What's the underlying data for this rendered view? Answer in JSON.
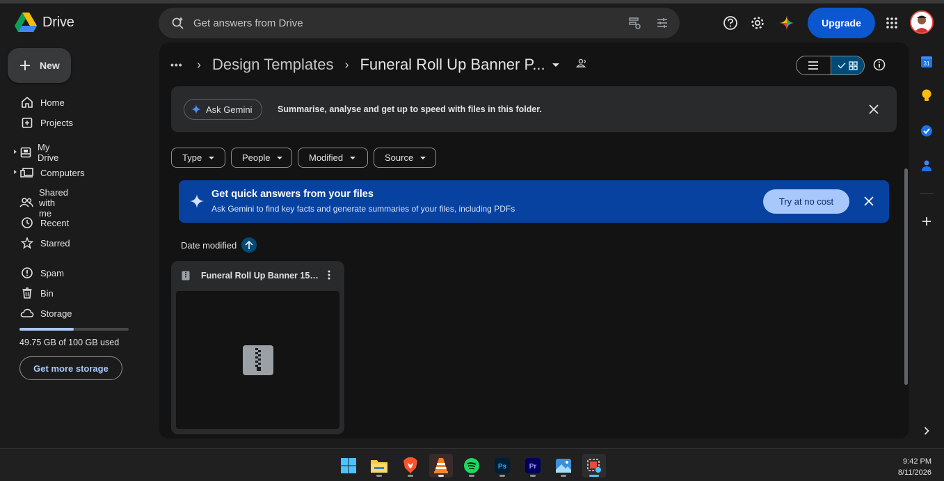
{
  "app": {
    "name": "Drive"
  },
  "search": {
    "placeholder": "Get answers from Drive"
  },
  "header": {
    "upgrade_label": "Upgrade"
  },
  "sidebar": {
    "new_label": "New",
    "items": [
      {
        "label": "Home",
        "icon": "home-icon"
      },
      {
        "label": "Projects",
        "icon": "projects-icon"
      },
      {
        "label": "My Drive",
        "icon": "my-drive-icon"
      },
      {
        "label": "Computers",
        "icon": "computers-icon"
      },
      {
        "label": "Shared with me",
        "icon": "shared-icon"
      },
      {
        "label": "Recent",
        "icon": "clock-icon"
      },
      {
        "label": "Starred",
        "icon": "star-icon"
      },
      {
        "label": "Spam",
        "icon": "spam-icon"
      },
      {
        "label": "Bin",
        "icon": "bin-icon"
      },
      {
        "label": "Storage",
        "icon": "cloud-icon"
      }
    ],
    "storage": {
      "used_fraction": 0.4975,
      "text": "49.75 GB of 100 GB used",
      "button": "Get more storage"
    }
  },
  "breadcrumb": {
    "parent": "Design Templates",
    "current": "Funeral Roll Up Banner P..."
  },
  "gemini_bar": {
    "button": "Ask Gemini",
    "description": "Summarise, analyse and get up to speed with files in this folder."
  },
  "filters": [
    "Type",
    "People",
    "Modified",
    "Source"
  ],
  "promo": {
    "title": "Get quick answers from your files",
    "subtitle": "Ask Gemini to find key facts and generate summaries of your files, including PDFs",
    "button": "Try at no cost"
  },
  "sort": {
    "label": "Date modified",
    "direction": "ascending"
  },
  "files": [
    {
      "name": "Funeral Roll Up Banner 15 i...",
      "type": "zip"
    }
  ],
  "rail": {
    "calendar_day": "31"
  },
  "taskbar": {
    "apps": [
      "windows-start",
      "file-explorer",
      "brave",
      "vlc",
      "spotify",
      "photoshop",
      "premiere",
      "photos",
      "snipping-tool"
    ],
    "time": "9:42 PM",
    "date": "8/11/2026"
  },
  "colors": {
    "accent": "#0b57d0",
    "promo_bg": "#0842a0",
    "light_accent": "#a8c7fa"
  }
}
